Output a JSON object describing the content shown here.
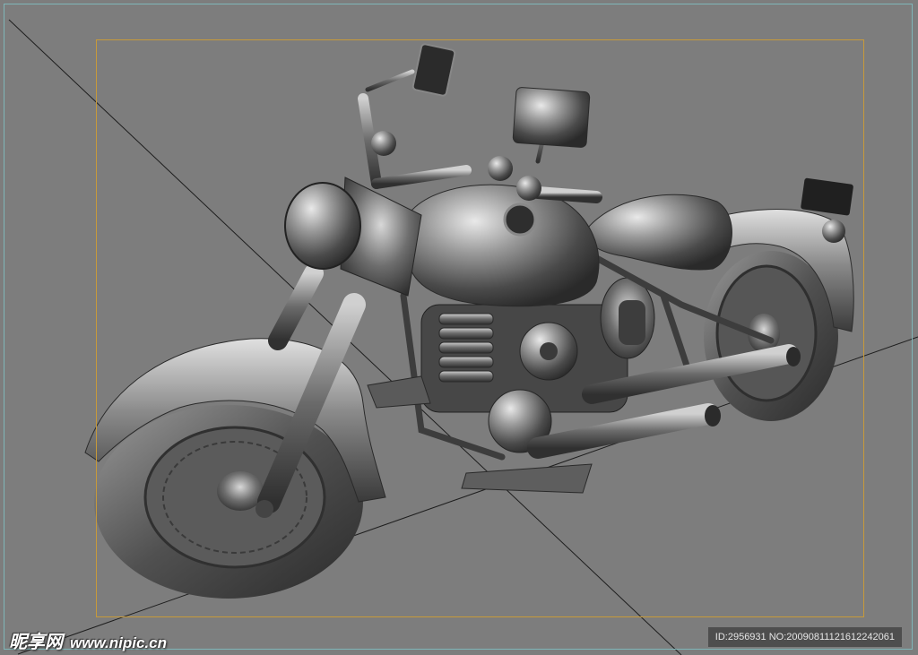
{
  "viewport": {
    "background": "#7d7d7d",
    "border_color": "#7fb6b8",
    "safe_frame_color": "#c79a3a"
  },
  "scene": {
    "subject": "motorcycle-model",
    "shading": "grayscale"
  },
  "watermark": {
    "site_cn": "昵享网",
    "site_url": "www.nipic.cn",
    "id_text": "ID:2956931 NO:20090811121612242061"
  }
}
